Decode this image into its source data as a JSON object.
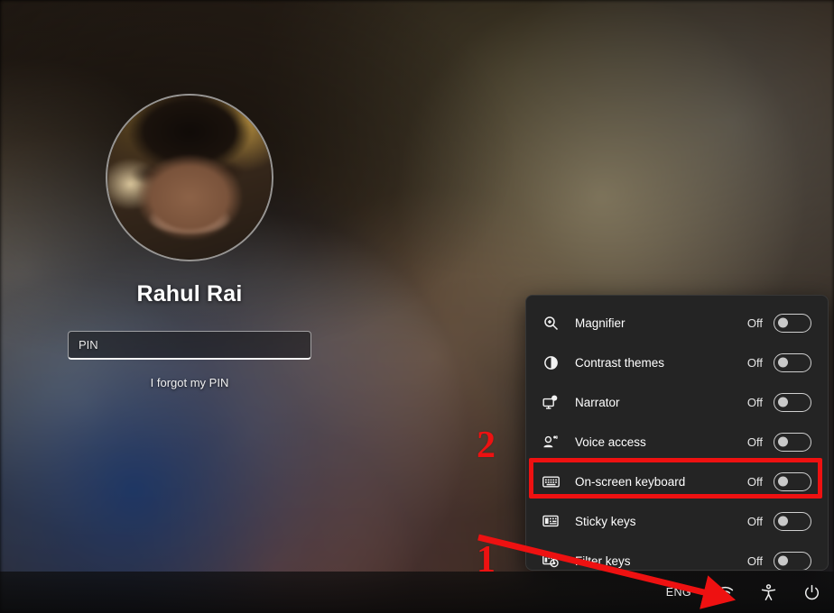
{
  "lockscreen": {
    "user_name": "Rahul Rai",
    "avatar_alt": "user-avatar-photo",
    "pin_placeholder": "PIN",
    "pin_value": "",
    "forgot_pin_label": "I forgot my PIN"
  },
  "accessibility_flyout": {
    "items": [
      {
        "label": "Magnifier",
        "state": "Off",
        "icon": "magnifier-icon",
        "checked": false,
        "highlighted": false
      },
      {
        "label": "Contrast themes",
        "state": "Off",
        "icon": "contrast-themes-icon",
        "checked": false,
        "highlighted": false
      },
      {
        "label": "Narrator",
        "state": "Off",
        "icon": "narrator-icon",
        "checked": false,
        "highlighted": false
      },
      {
        "label": "Voice access",
        "state": "Off",
        "icon": "voice-access-icon",
        "checked": false,
        "highlighted": false
      },
      {
        "label": "On-screen keyboard",
        "state": "Off",
        "icon": "on-screen-keyboard-icon",
        "checked": false,
        "highlighted": true
      },
      {
        "label": "Sticky keys",
        "state": "Off",
        "icon": "sticky-keys-icon",
        "checked": false,
        "highlighted": false
      },
      {
        "label": "Filter keys",
        "state": "Off",
        "icon": "filter-keys-icon",
        "checked": false,
        "highlighted": false
      }
    ]
  },
  "taskbar": {
    "language": "ENG",
    "wifi_icon": "wifi-icon",
    "accessibility_icon": "accessibility-icon",
    "power_icon": "power-icon"
  },
  "annotations": {
    "step_one": "1",
    "step_two": "2",
    "color": "#ee1111"
  }
}
